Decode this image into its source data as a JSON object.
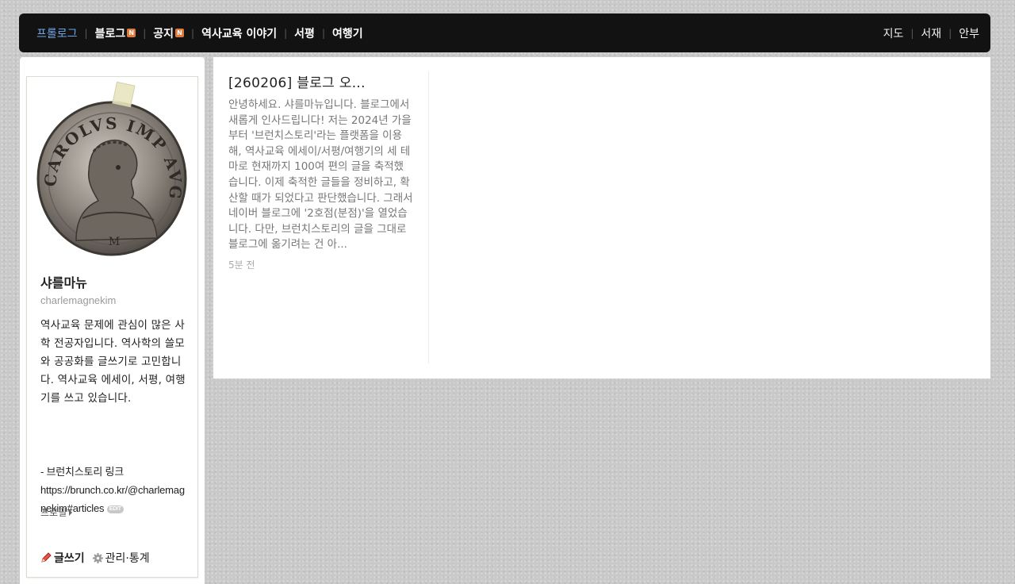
{
  "nav": {
    "left": [
      {
        "label": "프롤로그",
        "new": false,
        "active": true
      },
      {
        "label": "블로그",
        "new": true,
        "active": false
      },
      {
        "label": "공지",
        "new": true,
        "active": false
      },
      {
        "label": "역사교육 이야기",
        "new": false,
        "active": false
      },
      {
        "label": "서평",
        "new": false,
        "active": false
      },
      {
        "label": "여행기",
        "new": false,
        "active": false
      }
    ],
    "right": [
      "지도",
      "서재",
      "안부"
    ],
    "new_badge": "N"
  },
  "profile": {
    "name": "샤를마뉴",
    "id": "charlemagnekim",
    "bio": "역사교육 문제에 관심이 많은 사학 전공자입니다. 역사학의 쓸모와 공공화를 글쓰기로 고민합니다. 역사교육 에세이, 서평, 여행기를 쓰고 있습니다.",
    "link_line1": "- 브런치스토리 링크",
    "link_url": "https://brunch.co.kr/@charlemagnekim#articles",
    "edit_label": "EDIT",
    "more_label": "프로필",
    "write_label": "글쓰기",
    "manage_label": "관리·통계",
    "coin_text": "CAROLVS IMP AVG"
  },
  "post": {
    "title": "[260206] 블로그 오...",
    "excerpt": "안녕하세요. 샤를마뉴입니다. 블로그에서 새롭게 인사드립니다! 저는 2024년 가을부터 '브런치스토리'라는 플랫폼을 이용해, 역사교육 에세이/서평/여행기의 세 테마로 현재까지 100여 편의 글을 축적했습니다. 이제 축적한 글들을 정비하고, 확산할 때가 되었다고 판단했습니다. 그래서 네이버 블로그에 '2호점(분점)'을 열었습니다. 다만, 브런치스토리의 글을 그대로 블로그에 옮기려는 건 아...",
    "time": "5분 전"
  },
  "colors": {
    "topbar": "#121212",
    "active_nav": "#6fa6e6",
    "new_badge": "#e07a3a",
    "background": "#c9c9c9"
  }
}
